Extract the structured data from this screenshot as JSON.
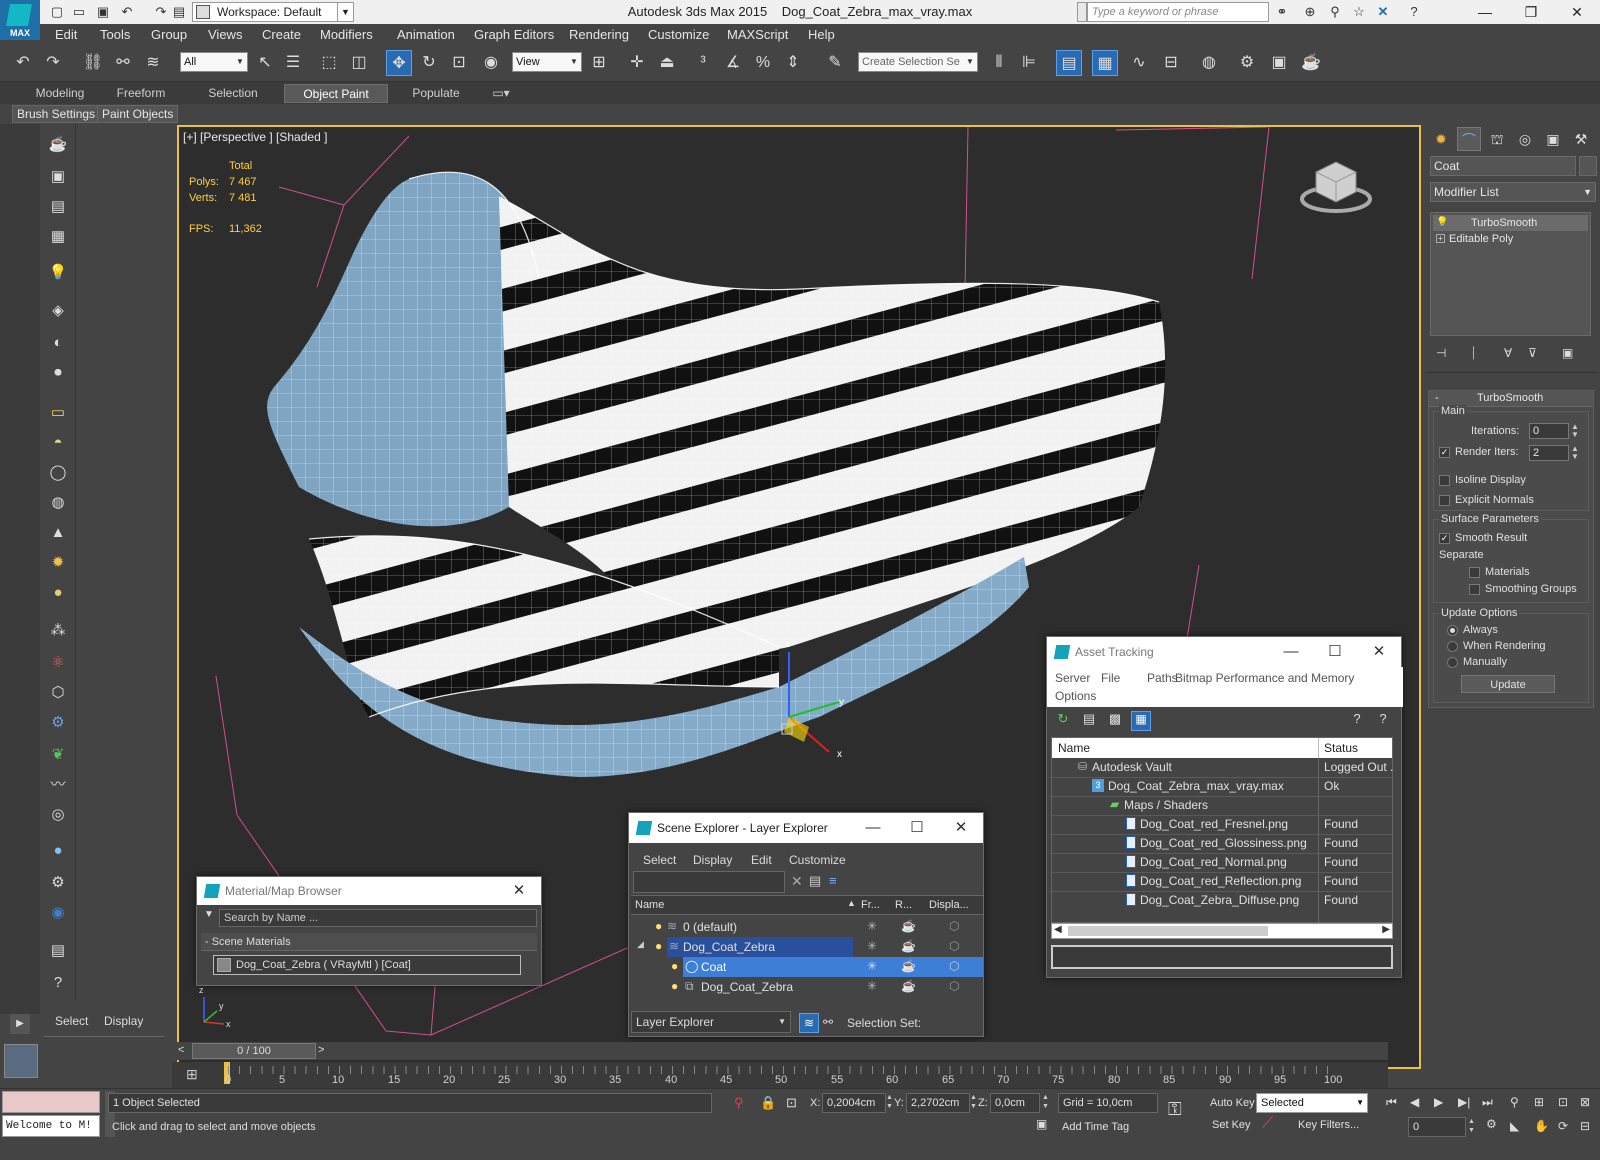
{
  "app": {
    "logo_text": "MAX",
    "title": "Autodesk 3ds Max  2015",
    "filename": "Dog_Coat_Zebra_max_vray.max",
    "workspace_label": "Workspace: Default",
    "search_placeholder": "Type a keyword or phrase"
  },
  "menu": [
    "Edit",
    "Tools",
    "Group",
    "Views",
    "Create",
    "Modifiers",
    "Animation",
    "Graph Editors",
    "Rendering",
    "Customize",
    "MAXScript",
    "Help"
  ],
  "toolbar": {
    "selection_filter": "All",
    "ref_coord": "View",
    "named_selection_placeholder": "Create Selection Se"
  },
  "ribbon": {
    "tabs": [
      "Modeling",
      "Freeform",
      "Selection",
      "Object Paint",
      "Populate"
    ],
    "active_tab": "Object Paint",
    "sub_buttons": [
      "Brush Settings",
      "Paint Objects"
    ]
  },
  "viewport": {
    "label": "[+] [Perspective ] [Shaded ]",
    "stats": {
      "total_label": "Total",
      "polys_label": "Polys:",
      "polys": "7 467",
      "verts_label": "Verts:",
      "verts": "7 481",
      "fps_label": "FPS:",
      "fps": "11,362"
    },
    "gizmo": {
      "x": "x",
      "y": "y",
      "z": "z"
    }
  },
  "command_panel": {
    "object_name": "Coat",
    "modifier_list_label": "Modifier List",
    "stack": [
      {
        "name": "TurboSmooth",
        "selected": true
      },
      {
        "name": "Editable Poly",
        "selected": false
      }
    ],
    "turbosmooth": {
      "title": "TurboSmooth",
      "main_label": "Main",
      "iterations_label": "Iterations:",
      "iterations": "0",
      "render_iters_label": "Render Iters:",
      "render_iters": "2",
      "render_iters_checked": true,
      "isoline_label": "Isoline Display",
      "explicit_normals_label": "Explicit Normals",
      "surface_params_label": "Surface Parameters",
      "smooth_result_label": "Smooth Result",
      "separate_label": "Separate",
      "materials_label": "Materials",
      "smoothing_groups_label": "Smoothing Groups",
      "update_options_label": "Update Options",
      "always_label": "Always",
      "when_rendering_label": "When Rendering",
      "manually_label": "Manually",
      "update_button": "Update"
    }
  },
  "asset_tracking": {
    "title": "Asset Tracking",
    "menu": [
      "Server",
      "File",
      "Paths",
      "Bitmap Performance and Memory",
      "Options"
    ],
    "col_name": "Name",
    "col_status": "Status",
    "rows": [
      {
        "name": "Autodesk Vault",
        "status": "Logged Out ."
      },
      {
        "name": "Dog_Coat_Zebra_max_vray.max",
        "status": "Ok"
      },
      {
        "name": "Maps / Shaders",
        "status": ""
      },
      {
        "name": "Dog_Coat_red_Fresnel.png",
        "status": "Found"
      },
      {
        "name": "Dog_Coat_red_Glossiness.png",
        "status": "Found"
      },
      {
        "name": "Dog_Coat_red_Normal.png",
        "status": "Found"
      },
      {
        "name": "Dog_Coat_red_Reflection.png",
        "status": "Found"
      },
      {
        "name": "Dog_Coat_Zebra_Diffuse.png",
        "status": "Found"
      }
    ]
  },
  "scene_explorer": {
    "title": "Scene Explorer - Layer Explorer",
    "menu": [
      "Select",
      "Display",
      "Edit",
      "Customize"
    ],
    "col_name": "Name",
    "col_fr": "Fr...",
    "col_r": "R...",
    "col_disp": "Displa...",
    "rows": [
      {
        "name": "0 (default)"
      },
      {
        "name": "Dog_Coat_Zebra"
      },
      {
        "name": "Coat"
      },
      {
        "name": "Dog_Coat_Zebra"
      }
    ],
    "footer_dropdown": "Layer Explorer",
    "selection_set_label": "Selection Set:"
  },
  "material_browser": {
    "title": "Material/Map Browser",
    "search_placeholder": "Search by Name ...",
    "group_label": "- Scene Materials",
    "item": "Dog_Coat_Zebra  ( VRayMtl )  [Coat]"
  },
  "left_bottom": {
    "tabs": [
      "Select",
      "Display"
    ]
  },
  "timeline": {
    "frame_display": "0 / 100",
    "ticks": [
      "0",
      "5",
      "10",
      "15",
      "20",
      "25",
      "30",
      "35",
      "40",
      "45",
      "50",
      "55",
      "60",
      "65",
      "70",
      "75",
      "80",
      "85",
      "90",
      "95",
      "100"
    ]
  },
  "status": {
    "maxscript_prompt": "Welcome to M!",
    "selection_text": "1 Object Selected",
    "prompt_text": "Click and drag to select and move objects",
    "x_label": "X:",
    "x": "0,2004cm",
    "y_label": "Y:",
    "y": "2,2702cm",
    "z_label": "Z:",
    "z": "0,0cm",
    "grid": "Grid = 10,0cm",
    "add_time_tag": "Add Time Tag",
    "auto_key": "Auto Key",
    "set_key": "Set Key",
    "key_mode": "Selected",
    "key_filters": "Key Filters...",
    "frame_field": "0"
  }
}
